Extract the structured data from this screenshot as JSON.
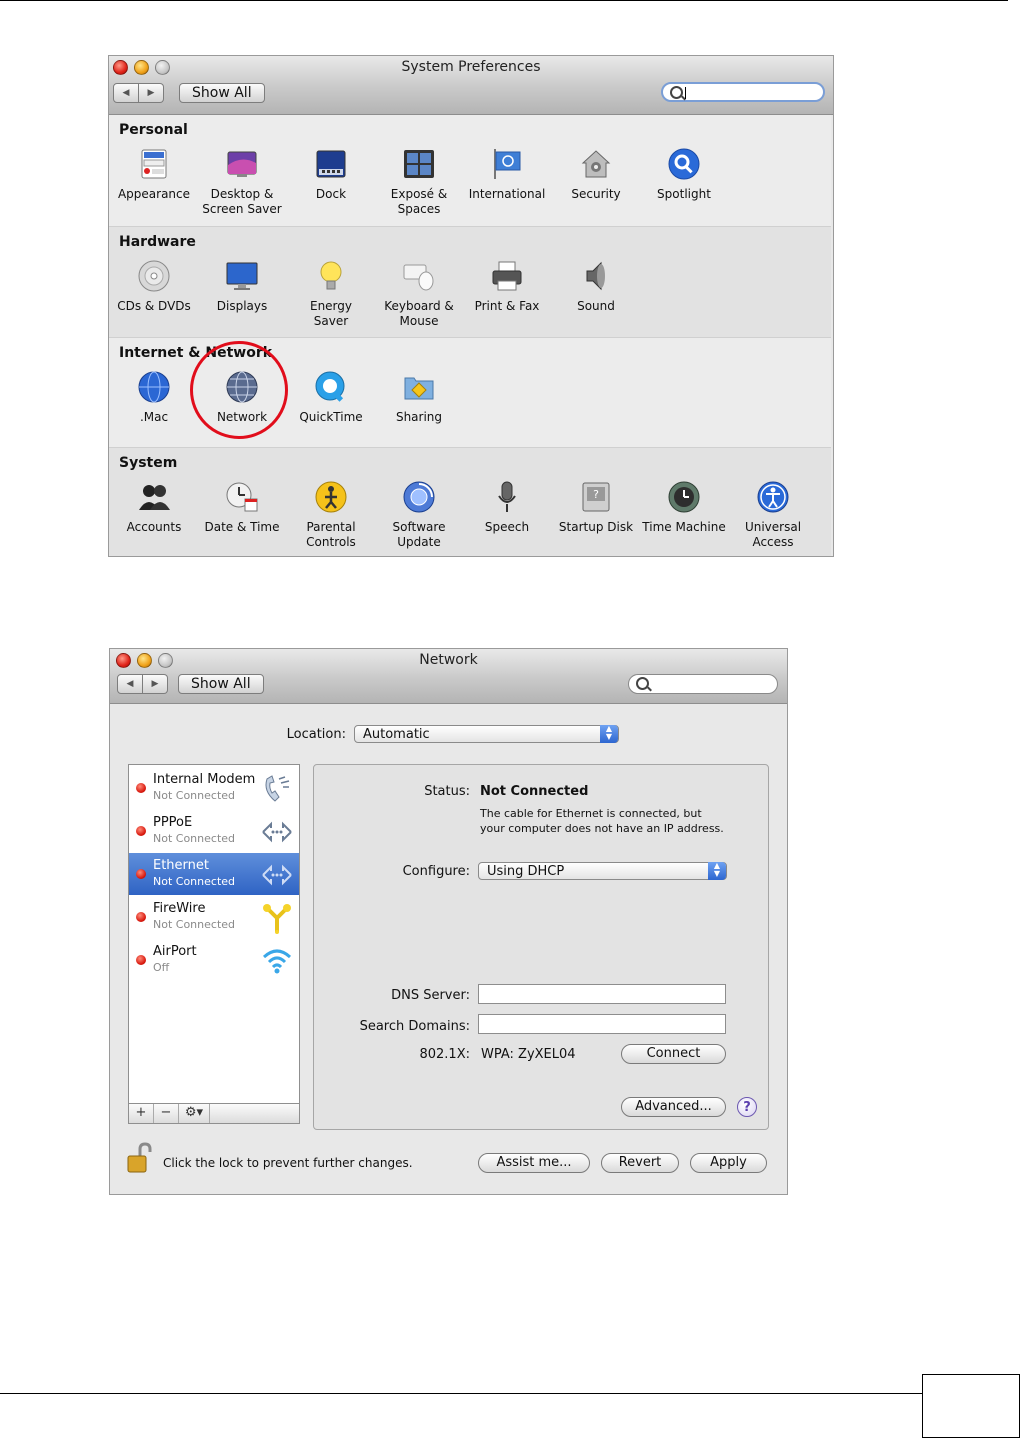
{
  "sysprefs": {
    "title": "System Preferences",
    "show_all": "Show All",
    "sections": {
      "personal": {
        "title": "Personal",
        "items": [
          "Appearance",
          "Desktop &\nScreen Saver",
          "Dock",
          "Exposé &\nSpaces",
          "International",
          "Security",
          "Spotlight"
        ]
      },
      "hardware": {
        "title": "Hardware",
        "items": [
          "CDs & DVDs",
          "Displays",
          "Energy\nSaver",
          "Keyboard &\nMouse",
          "Print & Fax",
          "Sound"
        ]
      },
      "internet": {
        "title": "Internet & Network",
        "items": [
          ".Mac",
          "Network",
          "QuickTime",
          "Sharing"
        ]
      },
      "system": {
        "title": "System",
        "items": [
          "Accounts",
          "Date & Time",
          "Parental\nControls",
          "Software\nUpdate",
          "Speech",
          "Startup Disk",
          "Time Machine",
          "Universal\nAccess"
        ]
      }
    }
  },
  "network": {
    "title": "Network",
    "show_all": "Show All",
    "location_label": "Location:",
    "location_value": "Automatic",
    "services": [
      {
        "name": "Internal Modem",
        "status": "Not Connected"
      },
      {
        "name": "PPPoE",
        "status": "Not Connected"
      },
      {
        "name": "Ethernet",
        "status": "Not Connected"
      },
      {
        "name": "FireWire",
        "status": "Not Connected"
      },
      {
        "name": "AirPort",
        "status": "Off"
      }
    ],
    "list_controls": {
      "add": "+",
      "remove": "−",
      "action": "⚙▾"
    },
    "status_label": "Status:",
    "status_value": "Not Connected",
    "status_desc_1": "The cable for Ethernet is connected, but",
    "status_desc_2": "your computer does not have an IP address.",
    "configure_label": "Configure:",
    "configure_value": "Using DHCP",
    "dns_label": "DNS Server:",
    "dns_value": "",
    "search_domains_label": "Search Domains:",
    "search_domains_value": "",
    "dot1x_label": "802.1X:",
    "dot1x_value": "WPA: ZyXEL04",
    "connect": "Connect",
    "advanced": "Advanced...",
    "help": "?",
    "lock_text": "Click the lock to prevent further changes.",
    "assist": "Assist me...",
    "revert": "Revert",
    "apply": "Apply"
  },
  "colors": {
    "accent": "#2f63c4",
    "highlight_circle": "#e10d1b",
    "error_dot": "#d8170c"
  }
}
